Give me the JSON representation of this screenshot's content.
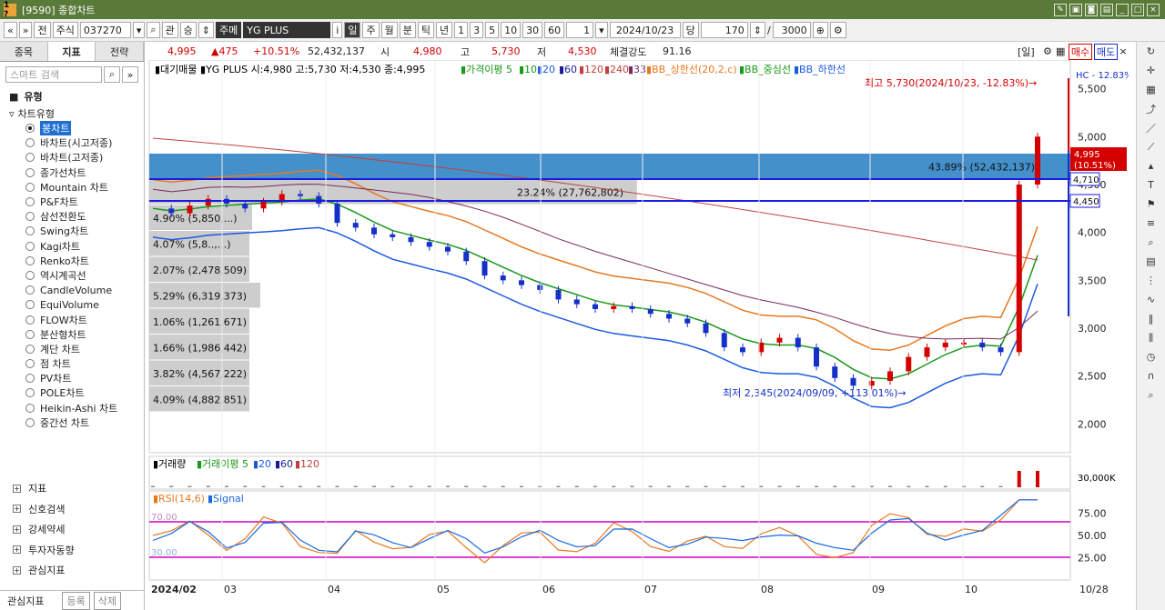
{
  "window": {
    "title": "[9590] 종합차트",
    "icon_label": "1 ?"
  },
  "toolbar": {
    "nav_prev": "«",
    "nav_next": "»",
    "btn_jeon": "전",
    "btn_stock": "주식",
    "code": "037270",
    "btn_gwan": "관",
    "btn_seung": "승",
    "market": "주메",
    "name": "YG PLUS",
    "btn_info": "i",
    "periods": [
      "일",
      "주",
      "월",
      "분",
      "틱",
      "년"
    ],
    "counts": [
      "1",
      "3",
      "5",
      "10",
      "30",
      "60"
    ],
    "interval": "1",
    "date": "2024/10/23",
    "btn_dang": "당",
    "view_count": "170",
    "total_count": "3000"
  },
  "left_panel": {
    "tabs": [
      "종목",
      "지표",
      "전략"
    ],
    "search_placeholder": "스마트 검색",
    "group_label": "유형",
    "subgroup_label": "차트유형",
    "chart_types": [
      "봉차트",
      "바차트(시고저종)",
      "바차트(고저종)",
      "종가선차트",
      "Mountain 차트",
      "P&F차트",
      "삼선전환도",
      "Swing차트",
      "Kagi차트",
      "Renko차트",
      "역시계곡선",
      "CandleVolume",
      "EquiVolume",
      "FLOW차트",
      "분산형차트",
      "계단 차트",
      "점 차트",
      "PV차트",
      "POLE차트",
      "Heikin-Ashi 차트",
      "중간선 차트"
    ],
    "bottom_groups": [
      "지표",
      "신호검색",
      "강세약세",
      "투자자동향",
      "관심지표"
    ],
    "footer_label": "관심지표",
    "footer_add": "등록",
    "footer_del": "삭제"
  },
  "infobar": {
    "price": "4,995",
    "change": "▲475",
    "change_pct": "+10.51%",
    "volume": "52,432,137",
    "open_label": "시",
    "open": "4,980",
    "high_label": "고",
    "high": "5,730",
    "low_label": "저",
    "low": "4,530",
    "strength_label": "체결강도",
    "strength": "91.16",
    "btn_il": "[일]",
    "btn_buy": "매수",
    "btn_sell": "매도"
  },
  "legend": {
    "main": "▮대기매물 ▮YG PLUS 시:4,980 고:5,730 저:4,530 종:4,995",
    "ma_label": "▮가격이평 5",
    "ma_10": "▮10",
    "ma_20": "▮20",
    "ma_60": "▮60",
    "ma_120": "▮120",
    "ma_240": "▮240",
    "ma_33": "▮33",
    "bb_up": "▮BB_상한선(20,2,c)",
    "bb_mid": "▮BB_중심선",
    "bb_low": "▮BB_하한선",
    "volume": "▮거래량",
    "vol_ma": "▮거래이평 5",
    "vol_20": "▮20",
    "vol_60": "▮60",
    "vol_120": "▮120",
    "rsi": "▮RSI(14,6)",
    "signal": "▮Signal"
  },
  "annotations": {
    "high": "최고 5,730(2024/10/23, -12.83%)→",
    "low": "최저 2,345(2024/09/09, +113.01%)→",
    "hc": "HC - 12.83%",
    "current_price": "4,995",
    "current_pct": "(10.51%)",
    "level_1": "4,710",
    "level_2": "4,450",
    "rsi_70": "70.00",
    "rsi_30": "30.00",
    "vol_axis": "30,000K"
  },
  "chart_data": {
    "type": "candlestick",
    "title": "",
    "x_ticks": [
      "2024/02",
      "03",
      "04",
      "05",
      "06",
      "07",
      "08",
      "09",
      "10",
      "10/28"
    ],
    "price_axis_ticks": [
      2000,
      2500,
      3000,
      3500,
      4000,
      4500,
      5000,
      5500
    ],
    "rsi_axis_ticks": [
      25,
      50,
      75
    ],
    "ylim": [
      1700,
      5800
    ],
    "high": 5730,
    "low": 2345,
    "volume_profile": [
      {
        "label": "43.89% (52,432,137)",
        "pct": 43.89
      },
      {
        "label": "23.24% (27,762,802)",
        "pct": 23.24
      },
      {
        "label": "4.90% (5,850,...)",
        "pct": 4.9
      },
      {
        "label": "4.07% (5,8..,...)",
        "pct": 4.07
      },
      {
        "label": "2.07% (2,478,509)",
        "pct": 2.07
      },
      {
        "label": "5.29% (6,319,373)",
        "pct": 5.29
      },
      {
        "label": "1.06% (1,261,671)",
        "pct": 1.06
      },
      {
        "label": "1.66% (1,986,442)",
        "pct": 1.66
      },
      {
        "label": "3.82% (4,567,222)",
        "pct": 3.82
      },
      {
        "label": "4.09% (4,882,851)",
        "pct": 4.09
      }
    ],
    "price_path": [
      4250,
      4200,
      4280,
      4350,
      4300,
      4250,
      4320,
      4400,
      4380,
      4300,
      4100,
      4050,
      3980,
      3950,
      3900,
      3850,
      3800,
      3700,
      3550,
      3500,
      3450,
      3400,
      3300,
      3250,
      3200,
      3230,
      3200,
      3150,
      3100,
      3050,
      2950,
      2800,
      2750,
      2850,
      2900,
      2800,
      2600,
      2480,
      2400,
      2450,
      2550,
      2700,
      2800,
      2850,
      2850,
      2800,
      2750,
      4500,
      5000
    ],
    "colors": {
      "up": "#d40000",
      "down": "#1530c8",
      "bb_up": "#e87820",
      "bb_mid": "#1a9a1a",
      "bb_low": "#1a5ae0",
      "ma_long": "#c04040",
      "ma_240": "#7a2a5a",
      "rsi": "#e87820",
      "signal": "#1a6ae0"
    }
  }
}
